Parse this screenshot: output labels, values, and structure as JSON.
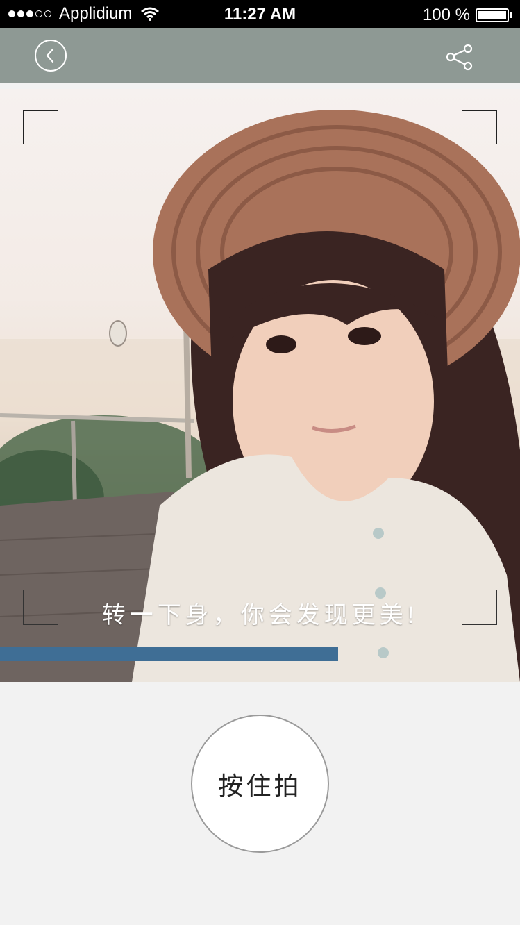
{
  "status_bar": {
    "carrier": "Applidium",
    "time": "11:27 AM",
    "battery": "100 %",
    "signal_bars_filled": 3,
    "signal_bars_total": 5
  },
  "nav": {
    "back_icon": "back-icon",
    "share_icon": "share-icon"
  },
  "camera": {
    "prompt": "转一下身，你会发现更美!",
    "progress_fraction": 0.65,
    "progress_color": "#3f6e95"
  },
  "shutter": {
    "label": "按住拍"
  },
  "colors": {
    "nav_background": "#8e9994",
    "page_background": "#f2f2f2"
  }
}
